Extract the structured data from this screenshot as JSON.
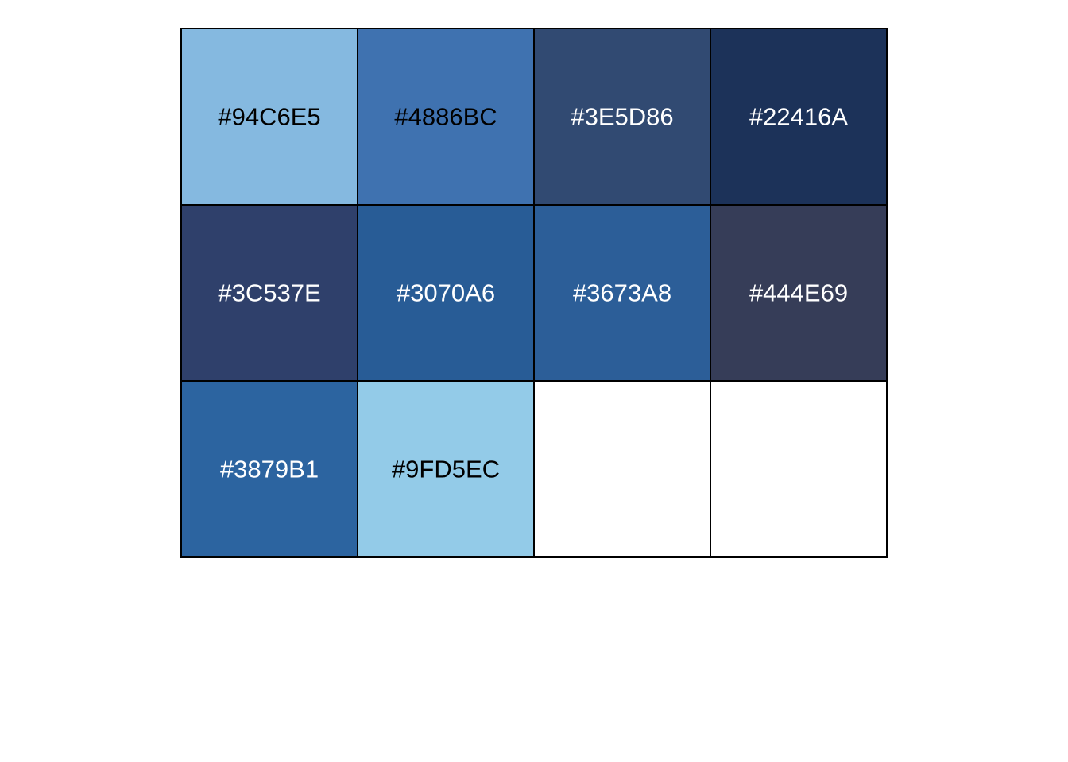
{
  "chart_data": {
    "type": "table",
    "columns": 4,
    "rows": 3,
    "swatches": [
      {
        "label": "#94C6E5",
        "color": "#85B9E0",
        "text_color": "#000000"
      },
      {
        "label": "#4886BC",
        "color": "#3F72B0",
        "text_color": "#000000"
      },
      {
        "label": "#3E5D86",
        "color": "#314A72",
        "text_color": "#ffffff"
      },
      {
        "label": "#22416A",
        "color": "#1C3259",
        "text_color": "#ffffff"
      },
      {
        "label": "#3C537E",
        "color": "#2F406B",
        "text_color": "#ffffff"
      },
      {
        "label": "#3070A6",
        "color": "#285C96",
        "text_color": "#ffffff"
      },
      {
        "label": "#3673A8",
        "color": "#2C5E98",
        "text_color": "#ffffff"
      },
      {
        "label": "#444E69",
        "color": "#363D58",
        "text_color": "#ffffff"
      },
      {
        "label": "#3879B1",
        "color": "#2C64A0",
        "text_color": "#ffffff"
      },
      {
        "label": "#9FD5EC",
        "color": "#93CBE8",
        "text_color": "#000000"
      },
      {
        "label": "",
        "color": "#ffffff",
        "text_color": "#000000"
      },
      {
        "label": "",
        "color": "#ffffff",
        "text_color": "#000000"
      }
    ]
  }
}
